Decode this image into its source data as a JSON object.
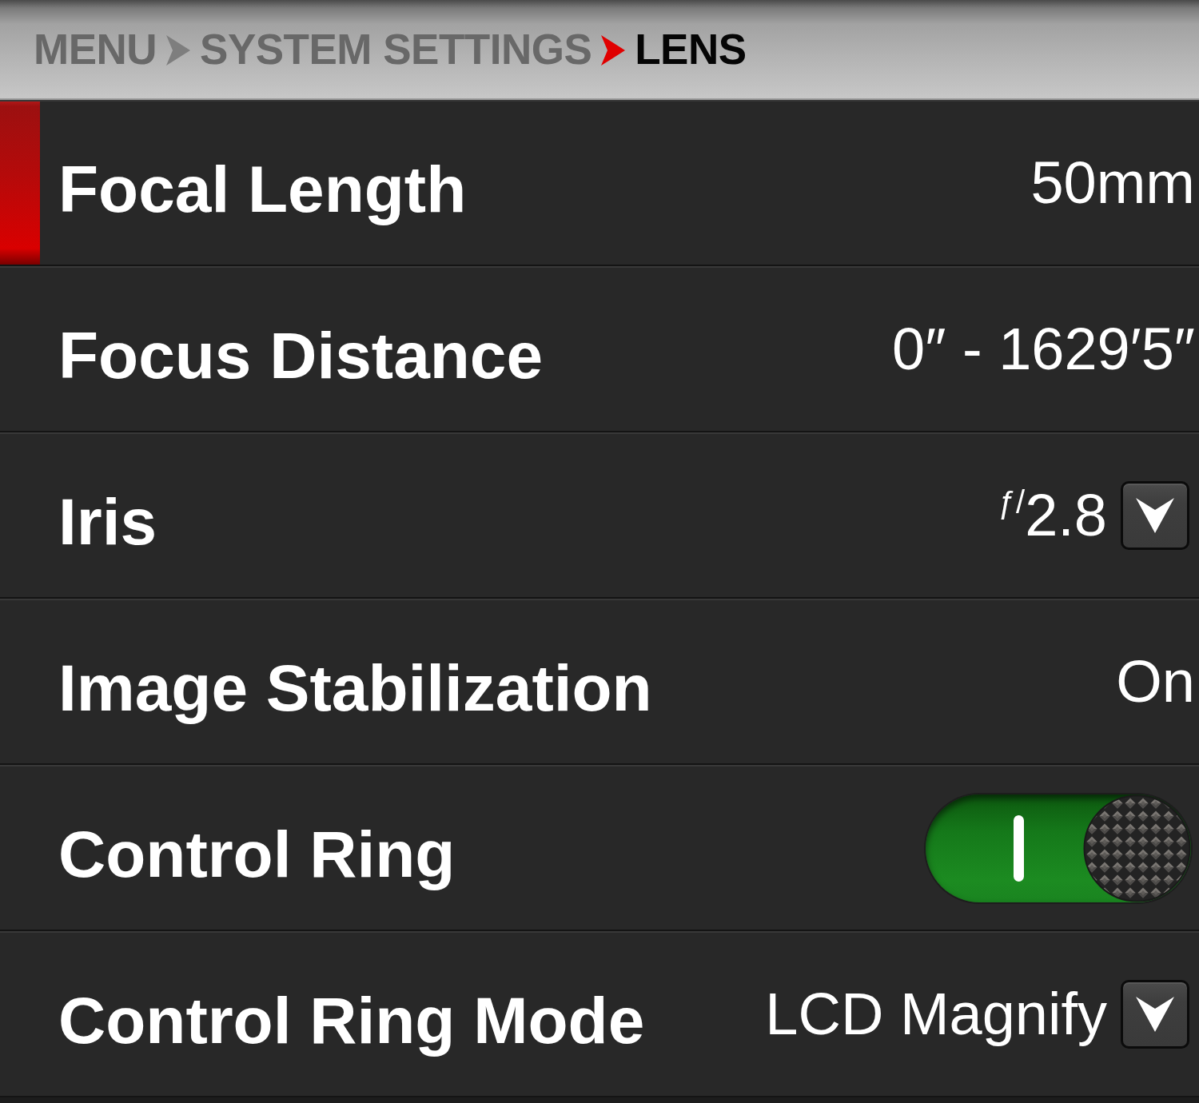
{
  "breadcrumb": [
    {
      "label": "MENU",
      "current": false
    },
    {
      "label": "SYSTEM SETTINGS",
      "current": false
    },
    {
      "label": "LENS",
      "current": true
    }
  ],
  "settings": [
    {
      "kind": "value",
      "label": "Focal Length",
      "value": "50mm",
      "selected": true
    },
    {
      "kind": "value",
      "label": "Focus Distance",
      "value": "0″ - 1629′5″",
      "selected": false
    },
    {
      "kind": "dropdown",
      "label": "Iris",
      "value": "$^{ƒ/}$2.8",
      "selected": false
    },
    {
      "kind": "value",
      "label": "Image Stabilization",
      "value": "On",
      "selected": false
    },
    {
      "kind": "toggle",
      "label": "Control Ring",
      "on": true,
      "selected": false
    },
    {
      "kind": "dropdown",
      "label": "Control Ring Mode",
      "value": "LCD Magnify",
      "selected": false
    }
  ]
}
